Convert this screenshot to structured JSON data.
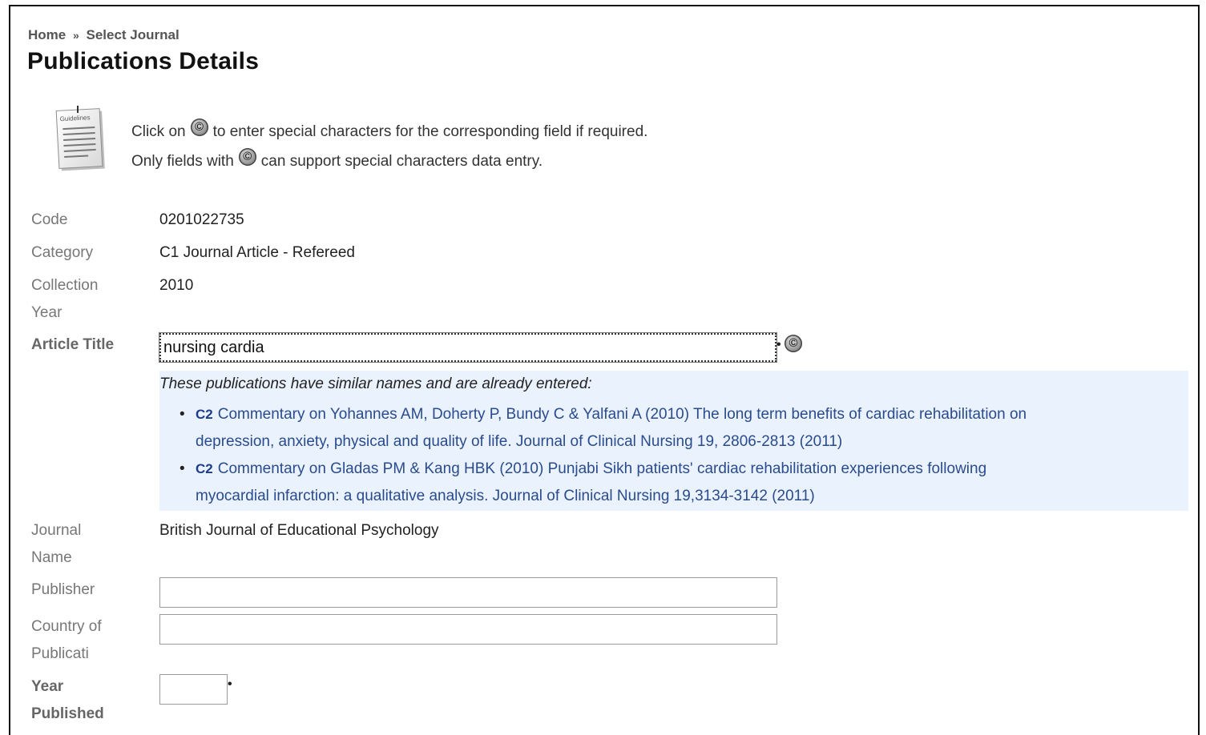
{
  "breadcrumb": {
    "home": "Home",
    "separator": "»",
    "current": "Select Journal"
  },
  "page_title": "Publications Details",
  "guidelines": {
    "icon_label": "Guidelines",
    "line1_before": "Click on",
    "line1_after": "to enter special characters for the corresponding field if required.",
    "line2_before": "Only fields with",
    "line2_after": "can support special characters data entry.",
    "special_char_glyph": "©"
  },
  "fields": {
    "code": {
      "label": "Code",
      "value": "0201022735"
    },
    "category": {
      "label": "Category",
      "value": "C1 Journal Article - Refereed"
    },
    "collection_year": {
      "label_line1": "Collection",
      "label_line2": "Year",
      "value": "2010"
    },
    "article_title": {
      "label": "Article Title",
      "value": "nursing cardia",
      "required_mark": "•"
    },
    "journal_name": {
      "label_line1": "Journal",
      "label_line2": "Name",
      "value": "British Journal of Educational Psychology"
    },
    "publisher": {
      "label": "Publisher",
      "value": ""
    },
    "country": {
      "label_line1": "Country of",
      "label_line2": "Publicati",
      "value": ""
    },
    "year_published": {
      "label_line1": "Year",
      "label_line2": "Published",
      "value": "",
      "required_mark": "•"
    }
  },
  "similar": {
    "heading": "These publications have similar names and are already entered:",
    "items": [
      {
        "code": "C2",
        "line1": "Commentary on Yohannes AM, Doherty P, Bundy C & Yalfani A (2010) The long term benefits of cardiac rehabilitation on",
        "line2": "depression, anxiety, physical and quality of life. Journal of Clinical Nursing 19, 2806-2813 (2011)"
      },
      {
        "code": "C2",
        "line1": "Commentary on Gladas PM & Kang HBK (2010) Punjabi Sikh patients' cardiac rehabilitation experiences following",
        "line2": "myocardial infarction: a qualitative analysis. Journal of Clinical Nursing 19,3134-3142 (2011)"
      }
    ]
  }
}
